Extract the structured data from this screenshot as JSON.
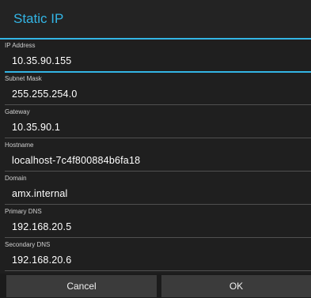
{
  "dialog": {
    "title": "Static IP"
  },
  "fields": [
    {
      "label": "IP Address",
      "value": "10.35.90.155",
      "focused": true
    },
    {
      "label": "Subnet Mask",
      "value": "255.255.254.0"
    },
    {
      "label": "Gateway",
      "value": "10.35.90.1"
    },
    {
      "label": "Hostname",
      "value": "localhost-7c4f800884b6fa18"
    },
    {
      "label": "Domain",
      "value": "amx.internal"
    },
    {
      "label": "Primary DNS",
      "value": "192.168.20.5"
    },
    {
      "label": "Secondary DNS",
      "value": "192.168.20.6"
    }
  ],
  "buttons": {
    "cancel_label": "Cancel",
    "ok_label": "OK"
  },
  "colors": {
    "accent": "#33b5e5",
    "background": "#1f1f1f",
    "button": "#3b3b3b",
    "text": "#ffffff"
  }
}
